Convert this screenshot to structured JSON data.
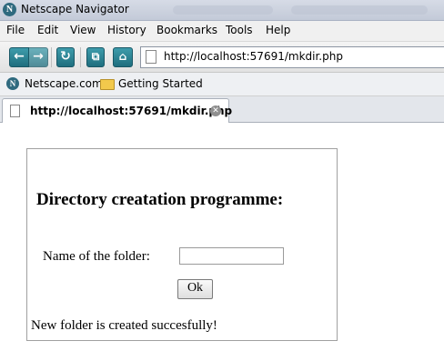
{
  "window": {
    "title": "Netscape Navigator",
    "logo_letter": "N"
  },
  "menu": [
    "File",
    "Edit",
    "View",
    "History",
    "Bookmarks",
    "Tools",
    "Help"
  ],
  "toolbar": {
    "url": "http://localhost:57691/mkdir.php",
    "icons": [
      "back-icon",
      "forward-icon",
      "reload-icon",
      "new-tab-icon",
      "home-icon"
    ],
    "accent_color": "#2a8596"
  },
  "bookmarks": [
    {
      "label": "Netscape.com",
      "icon": "netscape-icon"
    },
    {
      "label": "Getting Started",
      "icon": "folder-icon"
    }
  ],
  "tab": {
    "title": "http://localhost:57691/mkdir.php",
    "close_symbol": "✕"
  },
  "page": {
    "heading": "Directory creatation programme:",
    "folder_label": "Name of the folder:",
    "folder_value": "",
    "ok_label": "Ok",
    "status": "New folder is created succesfully!"
  }
}
